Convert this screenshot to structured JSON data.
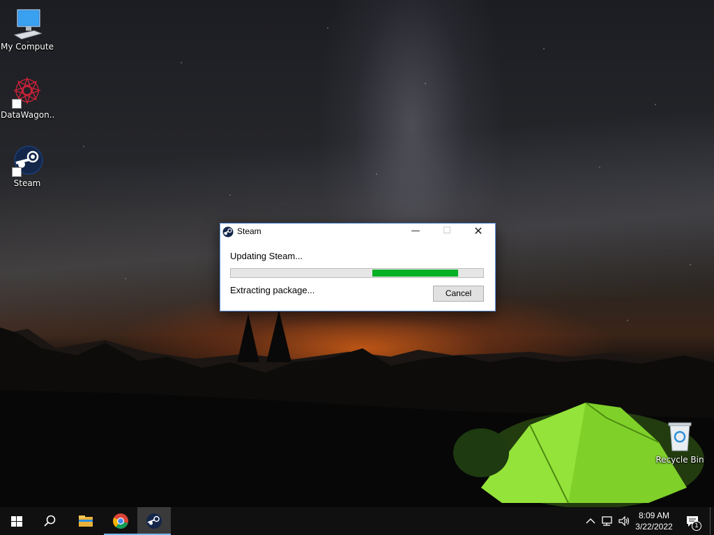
{
  "desktop": {
    "icons": [
      {
        "label": "My Computer",
        "icon": "monitor-icon"
      },
      {
        "label": "DataWagon...",
        "icon": "datawagon-logo-icon"
      },
      {
        "label": "Steam",
        "icon": "steam-icon"
      },
      {
        "label": "Recycle Bin",
        "icon": "recycle-bin-icon"
      }
    ]
  },
  "dialog": {
    "title": "Steam",
    "status": "Updating Steam...",
    "detail": "Extracting package...",
    "cancel_label": "Cancel",
    "minimize_glyph": "—",
    "maximize_glyph": "☐",
    "close_glyph": "✕",
    "progress": {
      "start": 0.56,
      "end": 0.9,
      "color": "#06b025"
    }
  },
  "taskbar": {
    "items": [
      "start-icon",
      "search-icon",
      "file-explorer-icon",
      "chrome-icon",
      "steam-icon"
    ],
    "active": "steam",
    "clock": {
      "time": "8:09 AM",
      "date": "3/22/2022"
    },
    "notification_count": "1"
  },
  "colors": {
    "accent": "#76b9ed",
    "progress": "#06b025",
    "taskbar": "#101010"
  }
}
